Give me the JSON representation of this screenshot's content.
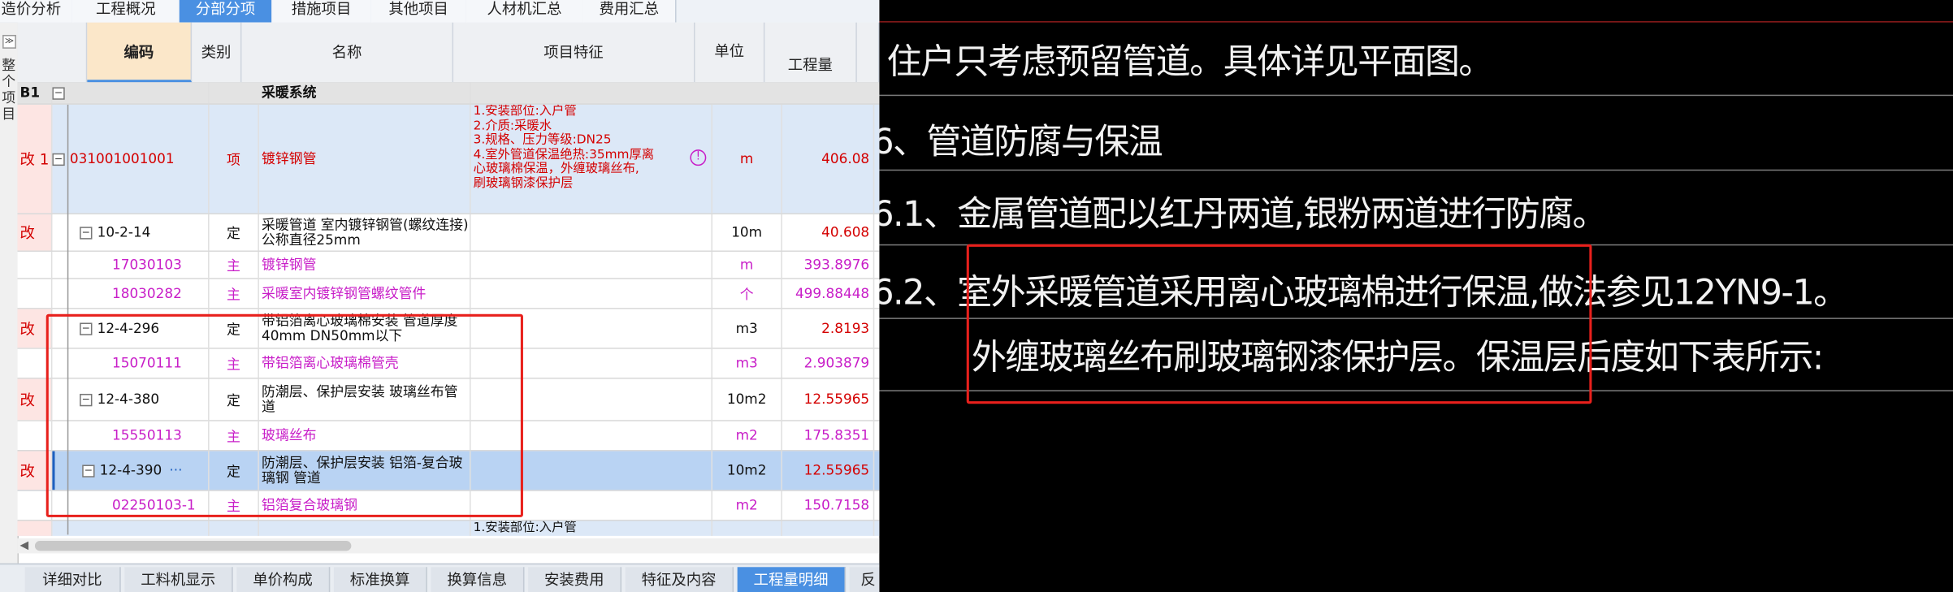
{
  "top_tabs": [
    "造价分析",
    "工程概况",
    "分部分项",
    "措施项目",
    "其他项目",
    "人材机汇总",
    "费用汇总"
  ],
  "left_strip": {
    "toggle": "≫",
    "text": "整个项目"
  },
  "headers": {
    "code": "编码",
    "type": "类别",
    "name": "名称",
    "feature": "项目特征",
    "unit": "单位",
    "qty": "工程量"
  },
  "group": {
    "id": "B1",
    "expander": "−",
    "name": "采暖系统"
  },
  "rows": [
    {
      "status": "改 1",
      "code": "031001001001",
      "type": "项",
      "name": "镀锌钢管",
      "features": [
        "1.安装部位:入户管",
        "2.介质:采暖水",
        "3.规格、压力等级:DN25",
        "4.室外管道保温绝热:35mm厚离",
        "心玻璃棉保温，外缠玻璃丝布,",
        "刷玻璃钢漆保护层"
      ],
      "info_icon": "!",
      "unit": "m",
      "qty": "406.08"
    },
    {
      "status": "改",
      "code": "10-2-14",
      "type": "定",
      "name": "采暖管道 室内镀锌钢管(螺纹连接) 公称直径25mm",
      "unit": "10m",
      "qty": "40.608"
    },
    {
      "status": "",
      "code": "17030103",
      "type": "主",
      "name": "镀锌钢管",
      "unit": "m",
      "qty": "393.8976"
    },
    {
      "status": "",
      "code": "18030282",
      "type": "主",
      "name": "采暖室内镀锌钢管螺纹管件",
      "unit": "个",
      "qty": "499.88448"
    },
    {
      "status": "改",
      "code": "12-4-296",
      "type": "定",
      "name": "带铝箔离心玻璃棉安装 管道厚度40mm DN50mm以下",
      "unit": "m3",
      "qty": "2.8193"
    },
    {
      "status": "",
      "code": "15070111",
      "type": "主",
      "name": "带铝箔离心玻璃棉管壳",
      "unit": "m3",
      "qty": "2.903879"
    },
    {
      "status": "改",
      "code": "12-4-380",
      "type": "定",
      "name": "防潮层、保护层安装 玻璃丝布管道",
      "unit": "10m2",
      "qty": "12.55965"
    },
    {
      "status": "",
      "code": "15550113",
      "type": "主",
      "name": "玻璃丝布",
      "unit": "m2",
      "qty": "175.8351"
    },
    {
      "status": "改",
      "code": "12-4-390",
      "type": "定",
      "name": "防潮层、保护层安装 铝箔-复合玻璃钢 管道",
      "unit": "10m2",
      "qty": "12.55965",
      "more": "···"
    },
    {
      "status": "",
      "code": "02250103-1",
      "type": "主",
      "name": "铝箔复合玻璃钢",
      "unit": "m2",
      "qty": "150.7158"
    },
    {
      "status": "",
      "code": "",
      "type": "",
      "name": "",
      "features": [
        "1.安装部位:入户管"
      ],
      "unit": "",
      "qty": ""
    }
  ],
  "bottom_tabs": [
    "详细对比",
    "工料机显示",
    "单价构成",
    "标准换算",
    "换算信息",
    "安装费用",
    "特征及内容",
    "工程量明细",
    "反"
  ],
  "cad": {
    "lines": [
      "住户只考虑预留管道。具体详见平面图。",
      "6、管道防腐与保温",
      "6.1、金属管道配以红丹两道,银粉两道进行防腐。",
      "6.2、室外采暖管道采用离心玻璃棉进行保温,做法参见12YN9-1。",
      "外缠玻璃丝布刷玻璃钢漆保护层。保温层后度如下表所示:"
    ]
  },
  "colors": {
    "highlight_box": "#e8201c",
    "active_tab": "#4a90e2",
    "modified_text": "#d40000",
    "material_text": "#c81ec8"
  }
}
